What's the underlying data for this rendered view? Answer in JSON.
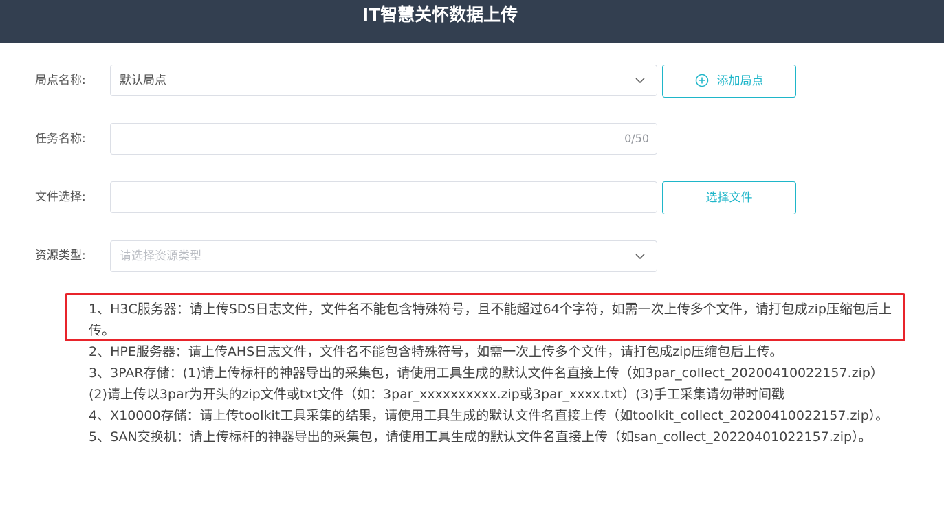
{
  "header": {
    "title": "IT智慧关怀数据上传"
  },
  "form": {
    "site": {
      "label": "局点名称:",
      "value": "默认局点",
      "add_button": "添加局点"
    },
    "task": {
      "label": "任务名称:",
      "value": "",
      "counter": "0/50"
    },
    "file": {
      "label": "文件选择:",
      "value": "",
      "select_button": "选择文件"
    },
    "resource": {
      "label": "资源类型:",
      "placeholder": "请选择资源类型"
    }
  },
  "notes": [
    "1、H3C服务器：请上传SDS日志文件，文件名不能包含特殊符号，且不能超过64个字符，如需一次上传多个文件，请打包成zip压缩包后上传。",
    " 2、HPE服务器：请上传AHS日志文件，文件名不能包含特殊符号，如需一次上传多个文件，请打包成zip压缩包后上传。",
    " 3、3PAR存储：(1)请上传标杆的神器导出的采集包，请使用工具生成的默认文件名直接上传（如3par_collect_20200410022157.zip）(2)请上传以3par为开头的zip文件或txt文件（如：3par_xxxxxxxxxx.zip或3par_xxxx.txt）(3)手工采集请勿带时间戳",
    "4、X10000存储：请上传toolkit工具采集的结果，请使用工具生成的默认文件名直接上传（如toolkit_collect_20200410022157.zip）。",
    "5、SAN交换机：请上传标杆的神器导出的采集包，请使用工具生成的默认文件名直接上传（如san_collect_20220401022157.zip）。"
  ],
  "colors": {
    "header_bg": "#333f50",
    "accent": "#1fb6c9",
    "highlight": "#e8242b"
  },
  "icons": {
    "add": "circle-plus-icon",
    "dropdown": "chevron-down-icon"
  }
}
